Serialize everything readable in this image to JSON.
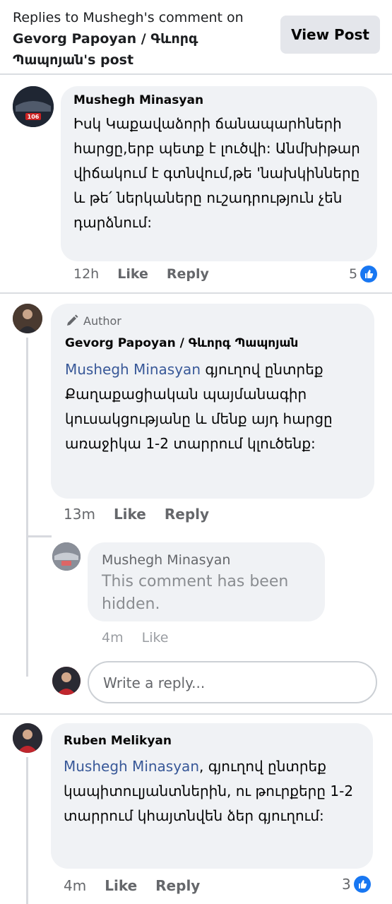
{
  "header": {
    "title_prefix": "Replies to ",
    "title_name": "Mushegh",
    "title_mid": "'s comment on",
    "title_page": "Gevorg Papoyan / Գևորգ Պապոյան",
    "title_suffix": "'s post",
    "view_post_label": "View Post"
  },
  "comments": [
    {
      "author": "Mushegh Minasyan",
      "text": "Իսկ Կաքավաձորի ճանապարհների հարցը,երբ պետք է լուծվի: Անմխիթար վիճակում է գտնվում,թե 'նախկինները և թե՛ ներկաները ուշադրություն չեն դարձնում:",
      "time": "12h",
      "like": "Like",
      "reply": "Reply",
      "reactions": "5"
    },
    {
      "badge": "Author",
      "author": "Gevorg Papoyan / Գևորգ Պապոյան",
      "mention": "Mushegh Minasyan",
      "text": " գյուղով ընտրեք Քաղաքացիական պայմանագիր կուսակցությանը և մենք այդ հարցը առաջիկա 1-2 տարրում կլուծենք:",
      "time": "13m",
      "like": "Like",
      "reply": "Reply"
    },
    {
      "author": "Mushegh Minasyan",
      "text": "This comment has been hidden.",
      "time": "4m",
      "like": "Like"
    },
    {
      "author": "Ruben Melikyan",
      "mention": "Mushegh Minasyan",
      "text": ", գյուղով ընտրեք կապիտուլյանտներին, ու թուրքերը 1-2 տարրում կհայտնվեն ձեր գյուղում:",
      "time": "4m",
      "like": "Like",
      "reply": "Reply",
      "reactions": "3"
    }
  ],
  "reply_input": {
    "placeholder": "Write a reply..."
  },
  "colors": {
    "link": "#385898",
    "bubble": "#f0f2f5",
    "like_blue": "#1877f2"
  }
}
